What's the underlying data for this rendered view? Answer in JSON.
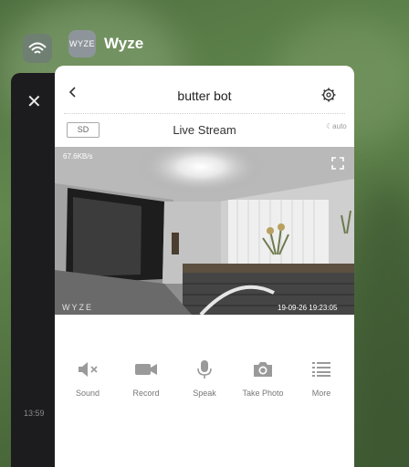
{
  "switcher": {
    "app_name": "Wyze",
    "app_icon_text": "WYZE",
    "bg_card_time": "13:59"
  },
  "device": {
    "title": "butter bot",
    "quality_badge": "SD",
    "mode_label": "Live Stream",
    "auto_label": "auto"
  },
  "stream": {
    "bitrate": "67.6KB/s",
    "timestamp": "19-09-26  19:23:05",
    "watermark": "WYZE"
  },
  "controls": [
    {
      "label": "Sound",
      "icon": "speaker-muted-icon"
    },
    {
      "label": "Record",
      "icon": "video-camera-icon"
    },
    {
      "label": "Speak",
      "icon": "microphone-icon"
    },
    {
      "label": "Take Photo",
      "icon": "camera-icon"
    },
    {
      "label": "More",
      "icon": "list-icon"
    }
  ],
  "colors": {
    "background": "#5a7d48",
    "card": "#ffffff",
    "icon_gray": "#9a9a9a"
  }
}
